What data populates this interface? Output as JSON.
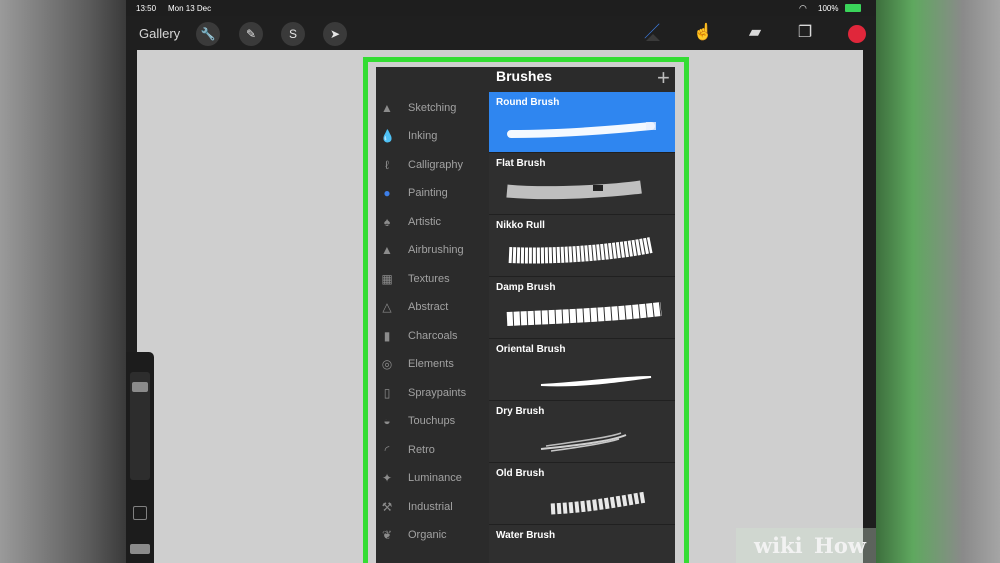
{
  "statusbar": {
    "time": "13:50",
    "date": "Mon 13 Dec",
    "battery": "100%"
  },
  "toolbar": {
    "gallery_label": "Gallery",
    "left_tools": [
      {
        "icon": "wrench-icon",
        "glyph": "🔧"
      },
      {
        "icon": "magic-wand-icon",
        "glyph": "✎"
      },
      {
        "icon": "selection-icon",
        "glyph": "S"
      },
      {
        "icon": "transform-arrow-icon",
        "glyph": "➤"
      }
    ],
    "right_tools": [
      {
        "icon": "paintbrush-icon",
        "glyph": "／"
      },
      {
        "icon": "smudge-icon",
        "glyph": "☝"
      },
      {
        "icon": "eraser-icon",
        "glyph": "▰"
      },
      {
        "icon": "layers-icon",
        "glyph": "❐"
      }
    ],
    "active_color": "#e0273b"
  },
  "brushes": {
    "title": "Brushes",
    "add_glyph": "+",
    "sets": [
      {
        "label": "Sketching",
        "icon": "sketching-icon",
        "glyph": "▲"
      },
      {
        "label": "Inking",
        "icon": "inking-icon",
        "glyph": "💧"
      },
      {
        "label": "Calligraphy",
        "icon": "calligraphy-icon",
        "glyph": "ℓ"
      },
      {
        "label": "Painting",
        "icon": "painting-icon",
        "glyph": "●"
      },
      {
        "label": "Artistic",
        "icon": "artistic-icon",
        "glyph": "♠"
      },
      {
        "label": "Airbrushing",
        "icon": "airbrushing-icon",
        "glyph": "▲"
      },
      {
        "label": "Textures",
        "icon": "textures-icon",
        "glyph": "▦"
      },
      {
        "label": "Abstract",
        "icon": "abstract-icon",
        "glyph": "△"
      },
      {
        "label": "Charcoals",
        "icon": "charcoals-icon",
        "glyph": "▮"
      },
      {
        "label": "Elements",
        "icon": "elements-icon",
        "glyph": "◎"
      },
      {
        "label": "Spraypaints",
        "icon": "spraypaints-icon",
        "glyph": "▯"
      },
      {
        "label": "Touchups",
        "icon": "touchups-icon",
        "glyph": "◒"
      },
      {
        "label": "Retro",
        "icon": "retro-icon",
        "glyph": "◜"
      },
      {
        "label": "Luminance",
        "icon": "luminance-icon",
        "glyph": "✦"
      },
      {
        "label": "Industrial",
        "icon": "industrial-icon",
        "glyph": "⚒"
      },
      {
        "label": "Organic",
        "icon": "organic-icon",
        "glyph": "❦"
      }
    ],
    "active_set": "Painting",
    "items": [
      {
        "name": "Round Brush"
      },
      {
        "name": "Flat Brush"
      },
      {
        "name": "Nikko Rull"
      },
      {
        "name": "Damp Brush"
      },
      {
        "name": "Oriental Brush"
      },
      {
        "name": "Dry Brush"
      },
      {
        "name": "Old Brush"
      },
      {
        "name": "Water Brush"
      }
    ],
    "active_brush": "Round Brush"
  },
  "watermark": {
    "wiki": "wiki",
    "how": "How"
  }
}
